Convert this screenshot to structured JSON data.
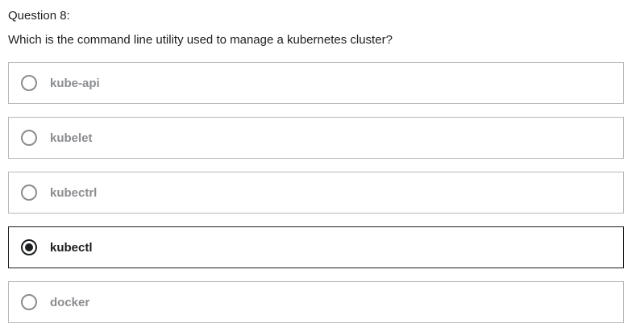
{
  "question": {
    "number_label": "Question 8:",
    "text": "Which is the command line utility used to manage a kubernetes cluster?"
  },
  "options": [
    {
      "label": "kube-api",
      "selected": false
    },
    {
      "label": "kubelet",
      "selected": false
    },
    {
      "label": "kubectrl",
      "selected": false
    },
    {
      "label": "kubectl",
      "selected": true
    },
    {
      "label": "docker",
      "selected": false
    }
  ],
  "colors": {
    "text": "#1c1d1f",
    "muted": "#8a8c8f",
    "border": "#b6b8bb",
    "selected_border": "#1c1d1f"
  },
  "icons": {
    "unselected": "radio-unselected-icon",
    "selected": "radio-selected-icon"
  }
}
